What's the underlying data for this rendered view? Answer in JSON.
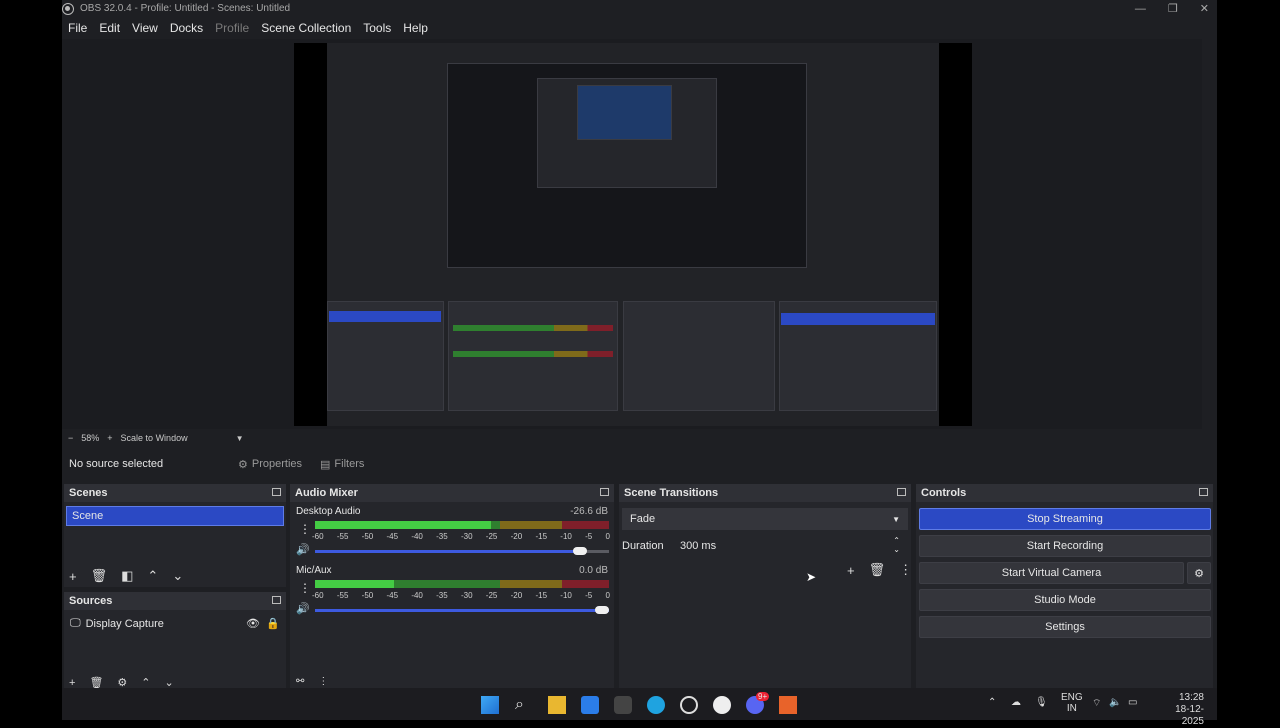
{
  "window": {
    "title": "OBS 32.0.4 - Profile: Untitled - Scenes: Untitled",
    "controls": [
      "—",
      "❐",
      "✕"
    ]
  },
  "menu": [
    "File",
    "Edit",
    "View",
    "Docks",
    "Profile",
    "Scene Collection",
    "Tools",
    "Help"
  ],
  "zoom": {
    "minus": "−",
    "level": "58%",
    "plus": "+",
    "mode": "Scale to Window",
    "caret": "▼"
  },
  "source_bar": {
    "status": "No source selected",
    "properties": "Properties",
    "filters": "Filters"
  },
  "scenes": {
    "title": "Scenes",
    "items": [
      "Scene"
    ]
  },
  "sources": {
    "title": "Sources",
    "items": [
      "Display Capture"
    ]
  },
  "audio": {
    "title": "Audio Mixer",
    "channels": [
      {
        "name": "Desktop Audio",
        "db": "-26.6 dB",
        "level": 0.6,
        "volume": 0.9
      },
      {
        "name": "Mic/Aux",
        "db": "0.0 dB",
        "level": 0.27,
        "volume": 1.0
      }
    ],
    "scale": [
      "-60",
      "-55",
      "-50",
      "-45",
      "-40",
      "-35",
      "-30",
      "-25",
      "-20",
      "-15",
      "-10",
      "-5",
      "0"
    ]
  },
  "transitions": {
    "title": "Scene Transitions",
    "selected": "Fade",
    "duration_label": "Duration",
    "duration_value": "300 ms"
  },
  "controls": {
    "title": "Controls",
    "stop_streaming": "Stop Streaming",
    "start_recording": "Start Recording",
    "start_virtual_camera": "Start Virtual Camera",
    "studio_mode": "Studio Mode",
    "settings": "Settings"
  },
  "taskbar": {
    "lang_top": "ENG",
    "lang_bottom": "IN",
    "time": "13:28",
    "date": "18-12-2025",
    "badge": "9+"
  }
}
